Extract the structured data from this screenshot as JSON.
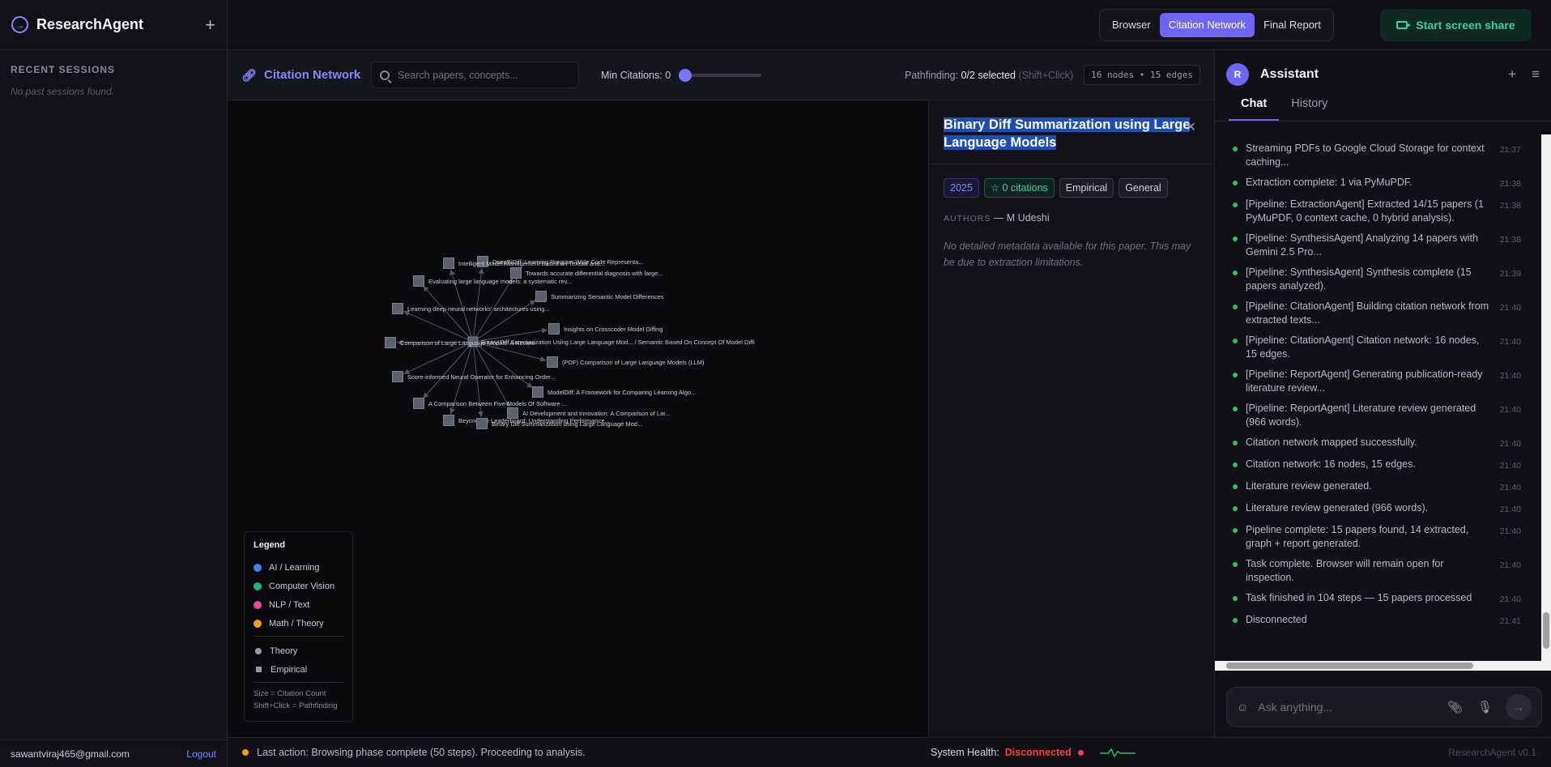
{
  "app": {
    "name": "ResearchAgent",
    "version": "ResearchAgent v0.1"
  },
  "sidebar": {
    "recent_label": "RECENT SESSIONS",
    "empty_text": "No past sessions found.",
    "user_email": "sawantviraj465@gmail.com",
    "logout_label": "Logout"
  },
  "topbar": {
    "tabs": [
      {
        "label": "Browser",
        "active": false
      },
      {
        "label": "Citation Network",
        "active": true
      },
      {
        "label": "Final Report",
        "active": false
      }
    ],
    "share_label": "Start screen share"
  },
  "graph_toolbar": {
    "title": "Citation Network",
    "search_placeholder": "Search papers, concepts...",
    "min_citations_label": "Min Citations: 0",
    "min_citations_value": 0,
    "pathfinding_label": "Pathfinding:",
    "pathfinding_value": "0/2 selected",
    "pathfinding_hint": "(Shift+Click)",
    "stats": "16 nodes • 15 edges"
  },
  "graph": {
    "center_label": "Binary Diff Summarization Using Large Language Mod... / Semantic Based On Concept Of Model Diffi",
    "node_color": "#5c6170",
    "edge_color": "#55555f",
    "nodes": [
      {
        "id": "n1",
        "label": "DeepBiDiff: Learning Program-Wide Code Representa..."
      },
      {
        "id": "n2",
        "label": "Intelligent Model Management Based on Textual and..."
      },
      {
        "id": "n3",
        "label": "Towards accurate differential diagnosis with large..."
      },
      {
        "id": "n4",
        "label": "Evaluating large language models: a systematic rev..."
      },
      {
        "id": "n5",
        "label": "Summarizing Semantic Model Differences"
      },
      {
        "id": "n6",
        "label": "Learning deep neural networks' architectures using..."
      },
      {
        "id": "n7",
        "label": "Insights on Crosscoder Model Diffing"
      },
      {
        "id": "n8",
        "label": "Comparison of Large Language Models: A Review"
      },
      {
        "id": "n9",
        "label": "(PDF) Comparison of Large Language Models (LLM)"
      },
      {
        "id": "n10",
        "label": "Score-informed Neural Operator for Enhancing Order..."
      },
      {
        "id": "n11",
        "label": "ModelDiff: A Framework for Comparing Learning Algo..."
      },
      {
        "id": "n12",
        "label": "A Comparison Between Five Models Of Software ..."
      },
      {
        "id": "n13",
        "label": "AI Development and Innovation: A Comparison of Lar..."
      },
      {
        "id": "n14",
        "label": "Beyond the Leaderboard: Understanding Performance..."
      },
      {
        "id": "n15",
        "label": "Binary Diff Summarization using Large Language Mod..."
      }
    ]
  },
  "legend": {
    "title": "Legend",
    "categories": [
      {
        "label": "AI / Learning",
        "color": "#3b82f6"
      },
      {
        "label": "Computer Vision",
        "color": "#10b981"
      },
      {
        "label": "NLP / Text",
        "color": "#ec4899"
      },
      {
        "label": "Math / Theory",
        "color": "#f59e0b"
      }
    ],
    "shapes": [
      {
        "label": "Theory",
        "shape": "circle"
      },
      {
        "label": "Empirical",
        "shape": "square"
      }
    ],
    "note_size": "Size = Citation Count",
    "note_shift": "Shift+Click = Pathfinding"
  },
  "detail": {
    "title": "Binary Diff Summarization using Large Language Models",
    "year": "2025",
    "citations": "0 citations",
    "tags": [
      "Empirical",
      "General"
    ],
    "authors_label": "AUTHORS",
    "authors": "— M Udeshi",
    "no_metadata": "No detailed metadata available for this paper. This may be due to extraction limitations."
  },
  "assistant": {
    "avatar_letter": "R",
    "title": "Assistant",
    "tabs": [
      {
        "label": "Chat",
        "active": true
      },
      {
        "label": "History",
        "active": false
      }
    ],
    "log": [
      {
        "text": "Streaming PDFs to Google Cloud Storage for context caching...",
        "time": "21:37"
      },
      {
        "text": "Extraction complete: 1 via PyMuPDF.",
        "time": "21:38"
      },
      {
        "text": "[Pipeline: ExtractionAgent] Extracted 14/15 papers (1 PyMuPDF, 0 context cache, 0 hybrid analysis).",
        "time": "21:38"
      },
      {
        "text": "[Pipeline: SynthesisAgent] Analyzing 14 papers with Gemini 2.5 Pro...",
        "time": "21:38"
      },
      {
        "text": "[Pipeline: SynthesisAgent] Synthesis complete (15 papers analyzed).",
        "time": "21:39"
      },
      {
        "text": "[Pipeline: CitationAgent] Building citation network from extracted texts...",
        "time": "21:40"
      },
      {
        "text": "[Pipeline: CitationAgent] Citation network: 16 nodes, 15 edges.",
        "time": "21:40"
      },
      {
        "text": "[Pipeline: ReportAgent] Generating publication-ready literature review...",
        "time": "21:40"
      },
      {
        "text": "[Pipeline: ReportAgent] Literature review generated (966 words).",
        "time": "21:40"
      },
      {
        "text": "Citation network mapped successfully.",
        "time": "21:40"
      },
      {
        "text": "Citation network: 16 nodes, 15 edges.",
        "time": "21:40"
      },
      {
        "text": "Literature review generated.",
        "time": "21:40"
      },
      {
        "text": "Literature review generated (966 words).",
        "time": "21:40"
      },
      {
        "text": "Pipeline complete: 15 papers found, 14 extracted, graph + report generated.",
        "time": "21:40"
      },
      {
        "text": "Task complete. Browser will remain open for inspection.",
        "time": "21:40"
      },
      {
        "text": "Task finished in 104 steps — 15 papers processed",
        "time": "21:40"
      },
      {
        "text": "Disconnected",
        "time": "21:41"
      }
    ],
    "input_placeholder": "Ask anything..."
  },
  "statusbar": {
    "last_action": "Last action: Browsing phase complete (50 steps). Proceeding to analysis.",
    "health_label": "System Health:",
    "health_value": "Disconnected"
  }
}
